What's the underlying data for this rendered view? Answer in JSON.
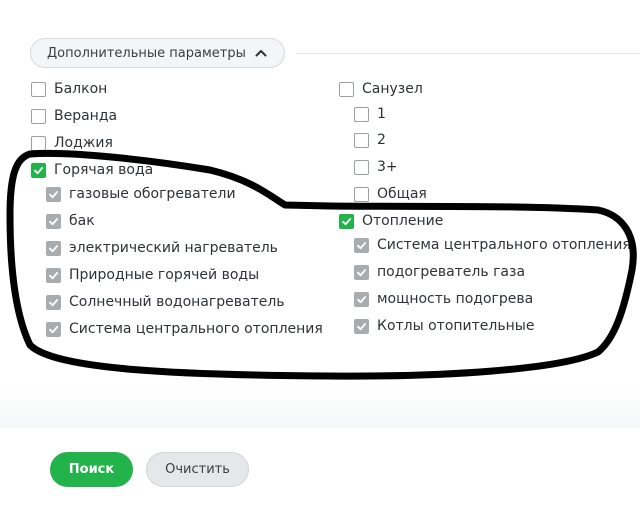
{
  "toggle": {
    "label": "Дополнительные параметры",
    "icon": "chevron-up-icon"
  },
  "left": [
    {
      "label": "Балкон",
      "state": "unchecked",
      "sub": false
    },
    {
      "label": "Веранда",
      "state": "unchecked",
      "sub": false
    },
    {
      "label": "Лоджия",
      "state": "unchecked",
      "sub": false
    },
    {
      "label": "Горячая вода",
      "state": "checked",
      "sub": false
    },
    {
      "label": "газовые обогреватели",
      "state": "checked-gray",
      "sub": true
    },
    {
      "label": "бак",
      "state": "checked-gray",
      "sub": true
    },
    {
      "label": "электрический нагреватель",
      "state": "checked-gray",
      "sub": true
    },
    {
      "label": "Природные горячей воды",
      "state": "checked-gray",
      "sub": true
    },
    {
      "label": "Солнечный водонагреватель",
      "state": "checked-gray",
      "sub": true
    },
    {
      "label": "Система центрального отопления",
      "state": "checked-gray",
      "sub": true
    }
  ],
  "right": [
    {
      "label": "Санузел",
      "state": "unchecked",
      "sub": false
    },
    {
      "label": "1",
      "state": "unchecked",
      "sub": true
    },
    {
      "label": "2",
      "state": "unchecked",
      "sub": true
    },
    {
      "label": "3+",
      "state": "unchecked",
      "sub": true
    },
    {
      "label": "Общая",
      "state": "unchecked",
      "sub": true
    },
    {
      "label": "Отопление",
      "state": "checked",
      "sub": false
    },
    {
      "label": "Система центрального отопления",
      "state": "checked-gray",
      "sub": true
    },
    {
      "label": "подогреватель газа",
      "state": "checked-gray",
      "sub": true
    },
    {
      "label": "мощность подогрева",
      "state": "checked-gray",
      "sub": true
    },
    {
      "label": "Котлы отопительные",
      "state": "checked-gray",
      "sub": true
    }
  ],
  "buttons": {
    "search": "Поиск",
    "clear": "Очистить"
  },
  "colors": {
    "accent": "#22b34a",
    "checked_sub": "#a9acaf",
    "annotation": "#000000"
  }
}
